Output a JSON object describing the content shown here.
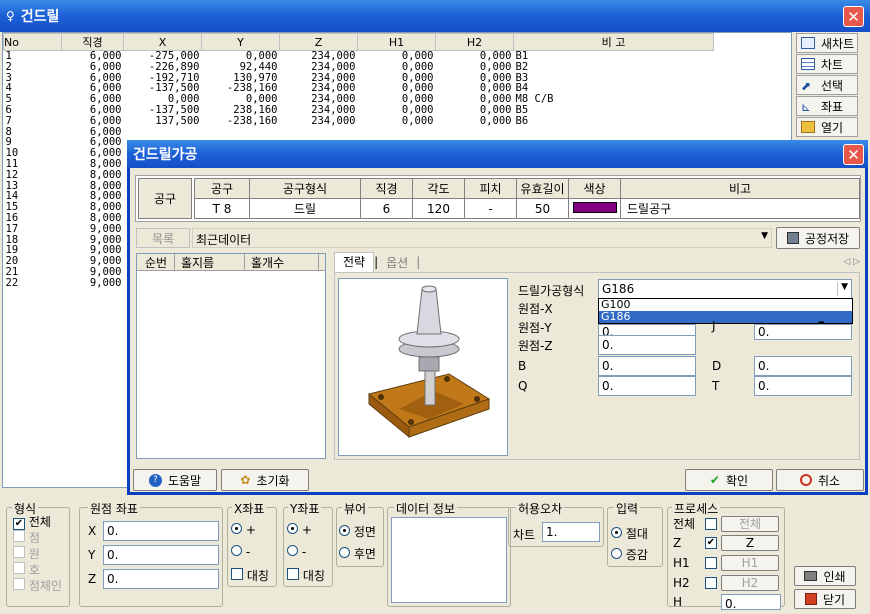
{
  "window": {
    "title": "건드릴"
  },
  "grid": {
    "headers": [
      "No",
      "직경",
      "X",
      "Y",
      "Z",
      "H1",
      "H2",
      "비 고"
    ],
    "rows": [
      [
        "1",
        "6,000",
        "-275,000",
        "0,000",
        "234,000",
        "0,000",
        "0,000",
        "B1"
      ],
      [
        "2",
        "6,000",
        "-226,890",
        "92,440",
        "234,000",
        "0,000",
        "0,000",
        "B2"
      ],
      [
        "3",
        "6,000",
        "-192,710",
        "130,970",
        "234,000",
        "0,000",
        "0,000",
        "B3"
      ],
      [
        "4",
        "6,000",
        "-137,500",
        "-238,160",
        "234,000",
        "0,000",
        "0,000",
        "B4"
      ],
      [
        "5",
        "6,000",
        "0,000",
        "0,000",
        "234,000",
        "0,000",
        "0,000",
        "M8 C/B"
      ],
      [
        "6",
        "6,000",
        "-137,500",
        "238,160",
        "234,000",
        "0,000",
        "0,000",
        "B5"
      ],
      [
        "7",
        "6,000",
        "137,500",
        "-238,160",
        "234,000",
        "0,000",
        "0,000",
        "B6"
      ],
      [
        "8",
        "6,000",
        "",
        "",
        "",
        "",
        "",
        ""
      ],
      [
        "9",
        "6,000",
        "",
        "",
        "",
        "",
        "",
        ""
      ],
      [
        "10",
        "6,000",
        "",
        "",
        "",
        "",
        "",
        ""
      ],
      [
        "11",
        "8,000",
        "",
        "",
        "",
        "",
        "",
        ""
      ],
      [
        "12",
        "8,000",
        "",
        "",
        "",
        "",
        "",
        ""
      ],
      [
        "13",
        "8,000",
        "",
        "",
        "",
        "",
        "",
        ""
      ],
      [
        "14",
        "8,000",
        "",
        "",
        "",
        "",
        "",
        ""
      ],
      [
        "15",
        "8,000",
        "",
        "",
        "",
        "",
        "",
        ""
      ],
      [
        "16",
        "8,000",
        "",
        "",
        "",
        "",
        "",
        ""
      ],
      [
        "17",
        "9,000",
        "",
        "",
        "",
        "",
        "",
        ""
      ],
      [
        "18",
        "9,000",
        "",
        "",
        "",
        "",
        "",
        ""
      ],
      [
        "19",
        "9,000",
        "",
        "",
        "",
        "",
        "",
        ""
      ],
      [
        "20",
        "9,000",
        "",
        "",
        "",
        "",
        "",
        ""
      ],
      [
        "21",
        "9,000",
        "",
        "",
        "",
        "",
        "",
        ""
      ],
      [
        "22",
        "9,000",
        "",
        "",
        "",
        "",
        "",
        ""
      ]
    ]
  },
  "side_buttons": [
    {
      "label": "새차트",
      "icon": "new-chart-icon"
    },
    {
      "label": "차트",
      "icon": "chart-icon"
    },
    {
      "label": "선택",
      "icon": "select-icon"
    },
    {
      "label": "좌표",
      "icon": "coordinate-icon"
    },
    {
      "label": "열기",
      "icon": "folder-icon"
    }
  ],
  "dialog": {
    "title": "건드릴가공",
    "tool": {
      "row_label": "공구",
      "headers": [
        "공구",
        "공구형식",
        "직경",
        "각도",
        "피치",
        "유효길이",
        "색상",
        "비고"
      ],
      "values": [
        "T 8",
        "드릴",
        "6",
        "120",
        "-",
        "50",
        "",
        "드릴공구"
      ],
      "color": "#800080"
    },
    "list_label": "목록",
    "list_value": "최근데이터",
    "save_process": "공정저장",
    "list_headers": [
      "순번",
      "홀지름",
      "홀개수"
    ],
    "tabs": [
      "전략",
      "옵션"
    ],
    "form": {
      "type_label": "드릴가공형식",
      "type_value": "G186",
      "options": [
        "G100",
        "G186"
      ],
      "origin_x": "원점-X",
      "origin_y": "원점-Y",
      "origin_z": "원점-Z",
      "oy_val": "0.",
      "oz_val": "0.",
      "j_label": "J",
      "j_val": "0.",
      "b": "B",
      "b_val": "0.",
      "d": "D",
      "d_val": "0.",
      "q": "Q",
      "q_val": "0.",
      "t": "T",
      "t_val": "0."
    },
    "help": "도움말",
    "reset": "초기화",
    "ok": "확인",
    "cancel": "취소"
  },
  "bottom": {
    "shape": {
      "title": "형식",
      "items": [
        "전체",
        "점",
        "원",
        "호",
        "점체인"
      ]
    },
    "origin": {
      "title": "원점 좌표",
      "x": "X",
      "y": "Y",
      "z": "Z",
      "xv": "0.",
      "yv": "0.",
      "zv": "0."
    },
    "xaxis": {
      "title": "X좌표",
      "plus": "+",
      "minus": "-",
      "sym": "대칭"
    },
    "yaxis": {
      "title": "Y좌표",
      "plus": "+",
      "minus": "-",
      "sym": "대칭"
    },
    "viewer": {
      "title": "뷰어",
      "front": "정면",
      "back": "후면"
    },
    "datainfo": {
      "title": "데이터 정보"
    },
    "tol": {
      "title": "허용오차",
      "chart": "차트",
      "value": "1."
    },
    "input": {
      "title": "입력",
      "abs": "절대",
      "inc": "증감"
    },
    "process": {
      "title": "프로세스",
      "all": "전체",
      "z": "Z",
      "h1": "H1",
      "h2": "H2",
      "h": "H",
      "hv": "0.",
      "ball": "전체",
      "bz": "Z",
      "bh1": "H1",
      "bh2": "H2"
    },
    "print": "인쇄",
    "close": "닫기"
  }
}
